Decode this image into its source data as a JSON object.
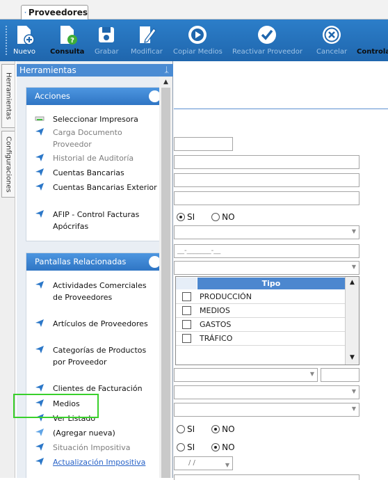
{
  "tab": {
    "title": "Proveedores"
  },
  "toolbar": {
    "buttons": [
      {
        "label": "Nuevo",
        "icon": "new-document-icon"
      },
      {
        "label": "Consulta",
        "icon": "query-document-icon"
      },
      {
        "label": "Grabar",
        "icon": "save-disk-icon"
      },
      {
        "label": "Modificar",
        "icon": "edit-pencil-icon"
      },
      {
        "label": "Copiar Medios",
        "icon": "play-circle-icon"
      },
      {
        "label": "Reactivar Proveedor",
        "icon": "checkmark-circle-icon"
      },
      {
        "label": "Cancelar",
        "icon": "cancel-x-circle-icon"
      },
      {
        "label": "Controla",
        "icon": ""
      }
    ]
  },
  "side_tabs": {
    "tools": "Herramientas",
    "config": "Configuraciones"
  },
  "panel": {
    "title": "Herramientas",
    "acciones": {
      "title": "Acciones",
      "items": [
        "Seleccionar Impresora",
        "Carga Documento Proveedor",
        "Historial de Auditoría",
        "Cuentas Bancarias",
        "Cuentas Bancarias Exterior",
        "AFIP - Control Facturas Apócrifas"
      ]
    },
    "pantallas": {
      "title": "Pantallas Relacionadas",
      "items": [
        "Actividades Comerciales de Proveedores",
        "Artículos de Proveedores",
        "Categorías de Productos por Proveedor",
        "Clientes de Facturación",
        "Medios",
        "Ver Listado",
        "(Agregar nueva)",
        "Situación Impositiva",
        "Actualización Impositiva"
      ]
    }
  },
  "form": {
    "radio1": {
      "si": "SI",
      "no": "NO",
      "selected": "SI"
    },
    "date_mask": "__-_______-__",
    "grid": {
      "header": "Tipo",
      "rows": [
        "PRODUCCIÓN",
        "MEDIOS",
        "GASTOS",
        "TRÁFICO"
      ]
    },
    "radio2": {
      "si": "SI",
      "no": "NO",
      "selected": "NO"
    },
    "radio3": {
      "si": "SI",
      "no": "NO",
      "selected": "NO"
    },
    "date2_mask": "/ /"
  },
  "colors": {
    "toolbar": "#1f66ad",
    "panel_header": "#4a8bd3",
    "box_header": "#2f75c4",
    "link": "#2762c7",
    "highlight": "#39d02b"
  }
}
